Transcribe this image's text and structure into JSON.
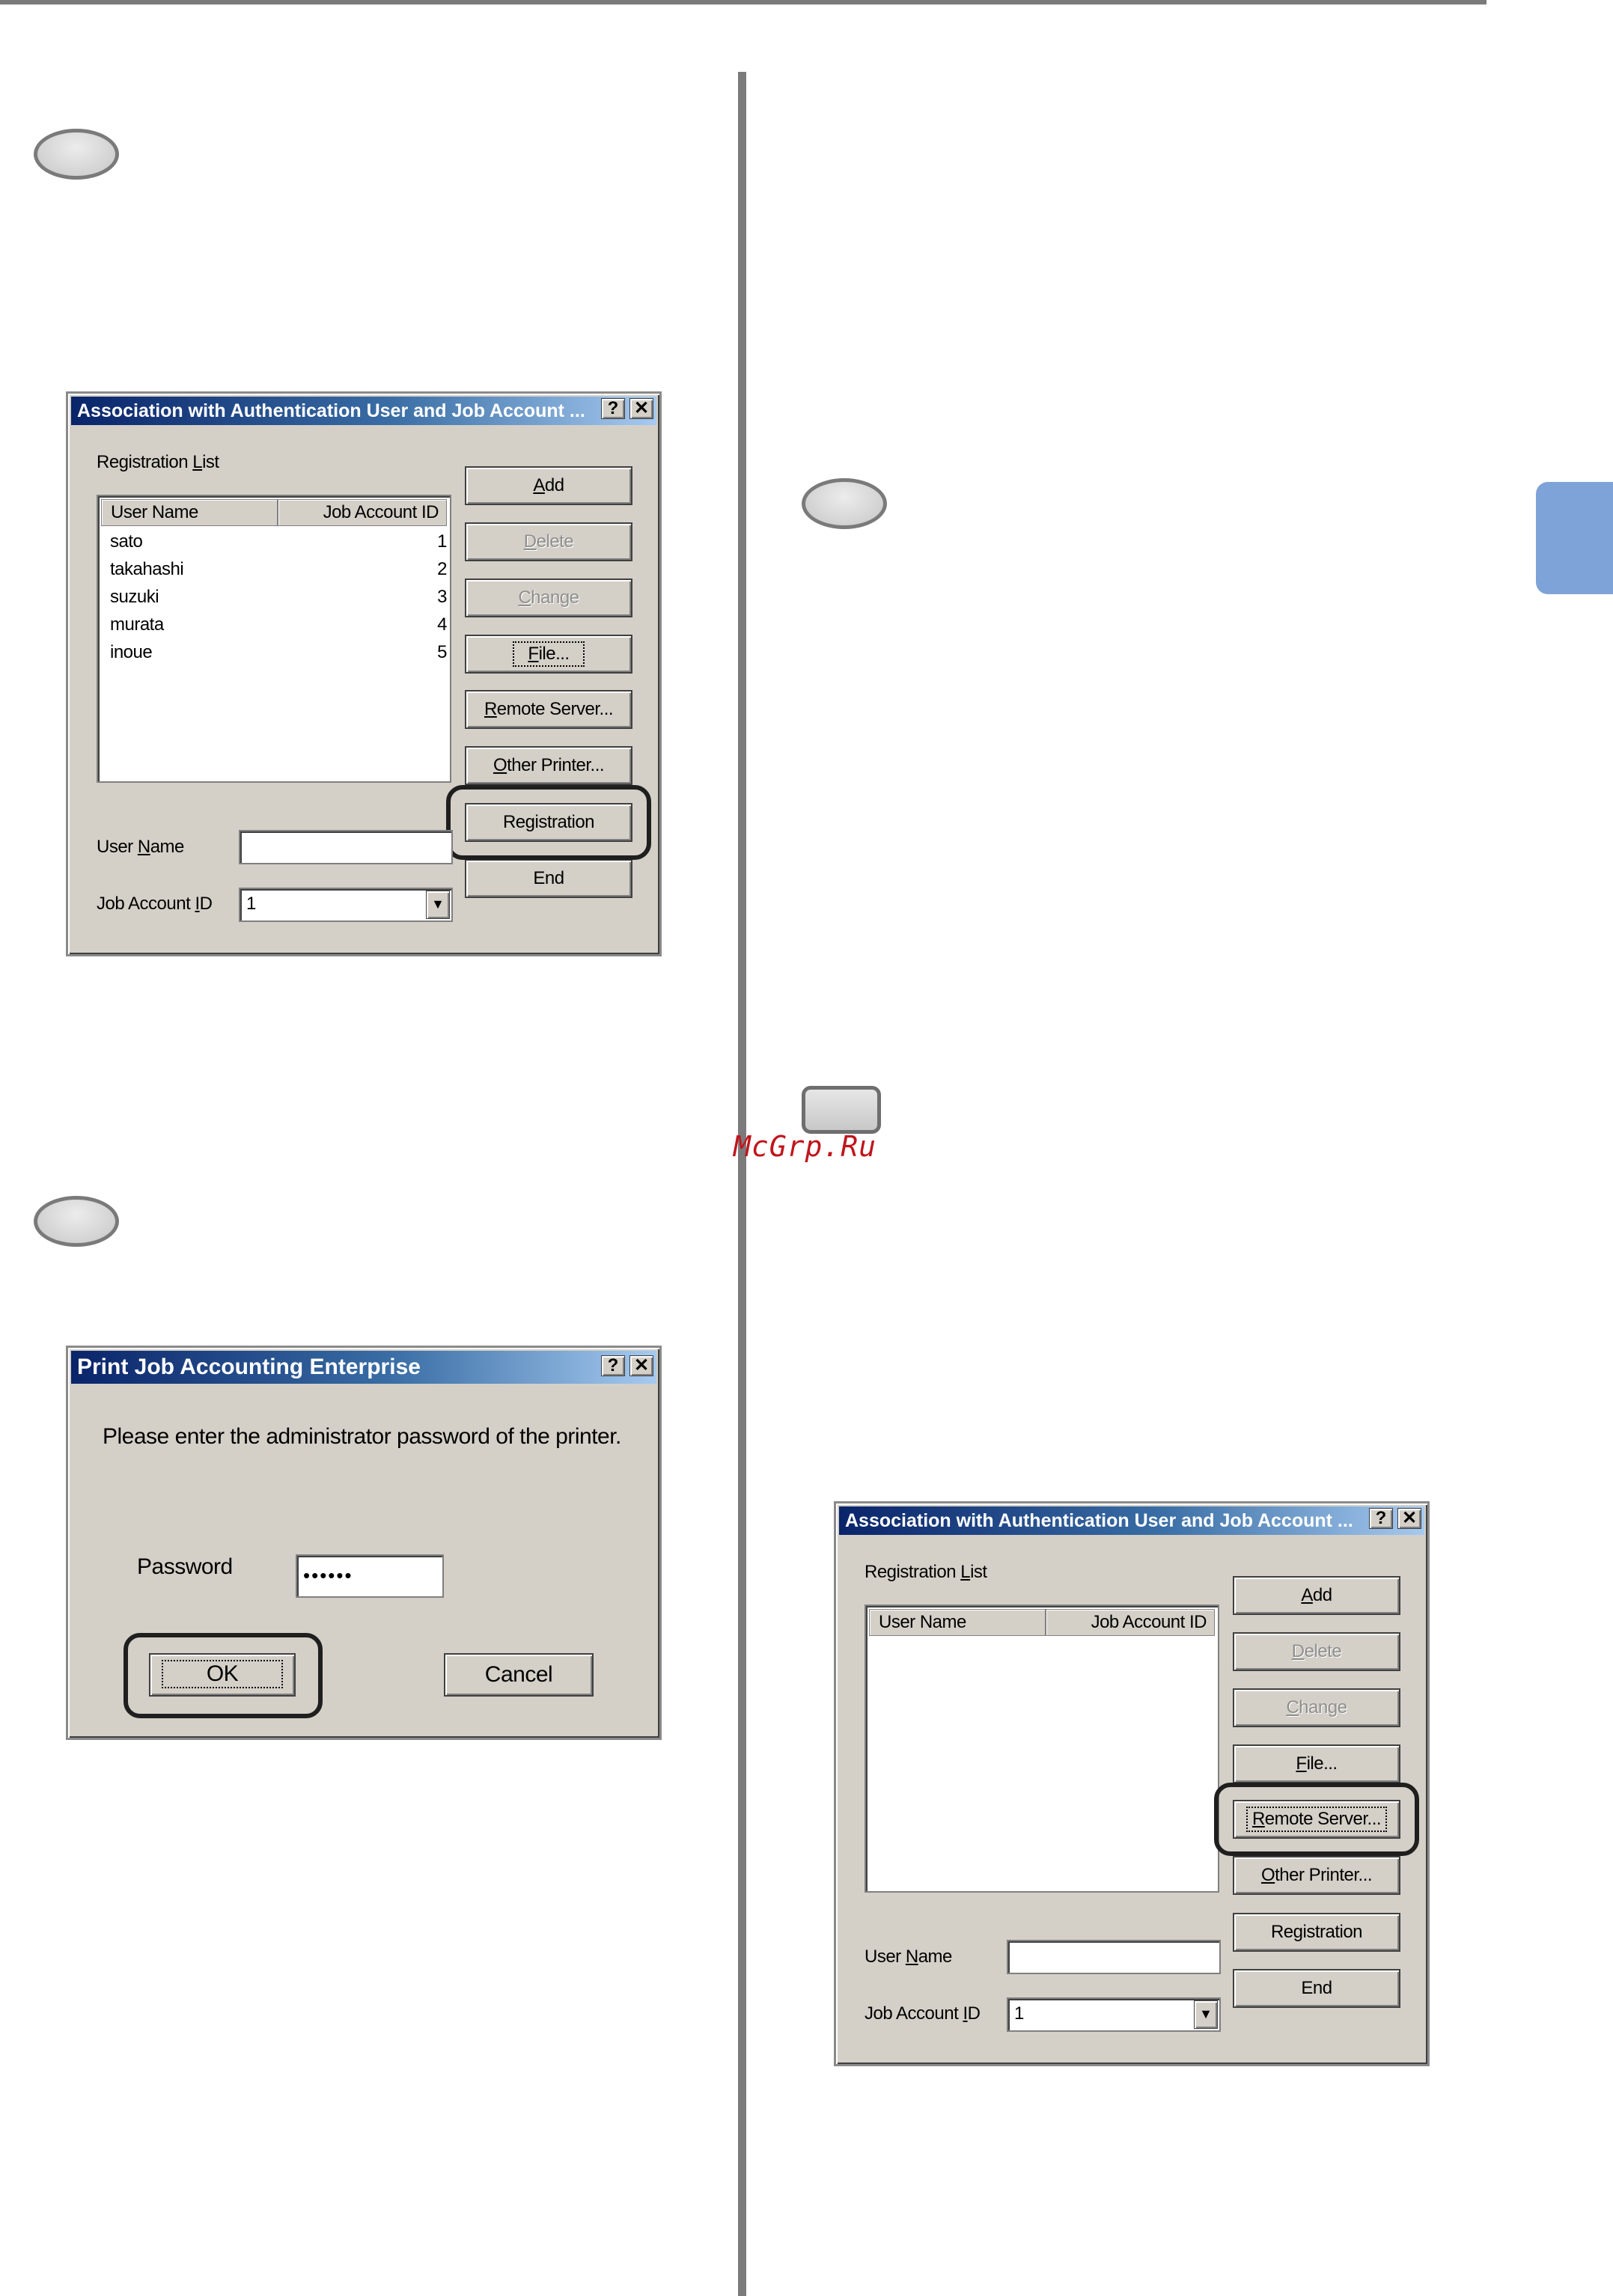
{
  "watermark": "McGrp.Ru",
  "dialog_assoc_1": {
    "title": "Association with Authentication User and Job Account ...",
    "help_btn": "?",
    "close_btn": "✕",
    "registration_list": {
      "pre": "Registration ",
      "key": "L",
      "post": "ist"
    },
    "columns": [
      "User Name",
      "Job Account ID"
    ],
    "rows": [
      {
        "name": "sato",
        "id": "1"
      },
      {
        "name": "takahashi",
        "id": "2"
      },
      {
        "name": "suzuki",
        "id": "3"
      },
      {
        "name": "murata",
        "id": "4"
      },
      {
        "name": "inoue",
        "id": "5"
      }
    ],
    "buttons": {
      "add": {
        "pre": "",
        "key": "A",
        "post": "dd"
      },
      "delete": {
        "pre": "",
        "key": "D",
        "post": "elete"
      },
      "change": {
        "pre": "",
        "key": "C",
        "post": "hange"
      },
      "file": {
        "pre": "",
        "key": "F",
        "post": "ile..."
      },
      "remote": {
        "pre": "",
        "key": "R",
        "post": "emote Server..."
      },
      "other": {
        "pre": "",
        "key": "O",
        "post": "ther Printer..."
      },
      "registration": "Registration",
      "end": "End"
    },
    "user_name_label": {
      "pre": "User ",
      "key": "N",
      "post": "ame"
    },
    "user_name_value": "",
    "job_account_label": {
      "pre": "Job Account ",
      "key": "I",
      "post": "D"
    },
    "job_account_value": "1"
  },
  "dialog_password": {
    "title": "Print Job Accounting Enterprise",
    "help_btn": "?",
    "close_btn": "✕",
    "message": "Please enter the administrator password of the printer.",
    "password_label": "Password",
    "password_value": "••••••",
    "ok": "OK",
    "cancel": "Cancel"
  },
  "dialog_assoc_2": {
    "title": "Association with Authentication User and Job Account ...",
    "help_btn": "?",
    "close_btn": "✕",
    "registration_list": {
      "pre": "Registration ",
      "key": "L",
      "post": "ist"
    },
    "columns": [
      "User Name",
      "Job Account ID"
    ],
    "buttons": {
      "add": {
        "pre": "",
        "key": "A",
        "post": "dd"
      },
      "delete": {
        "pre": "",
        "key": "D",
        "post": "elete"
      },
      "change": {
        "pre": "",
        "key": "C",
        "post": "hange"
      },
      "file": {
        "pre": "",
        "key": "F",
        "post": "ile..."
      },
      "remote": {
        "pre": "",
        "key": "R",
        "post": "emote Server..."
      },
      "other": {
        "pre": "",
        "key": "O",
        "post": "ther Printer..."
      },
      "registration": "Registration",
      "end": "End"
    },
    "user_name_label": {
      "pre": "User ",
      "key": "N",
      "post": "ame"
    },
    "user_name_value": "",
    "job_account_label": {
      "pre": "Job Account ",
      "key": "I",
      "post": "D"
    },
    "job_account_value": "1"
  },
  "combo_arrow": "▼"
}
